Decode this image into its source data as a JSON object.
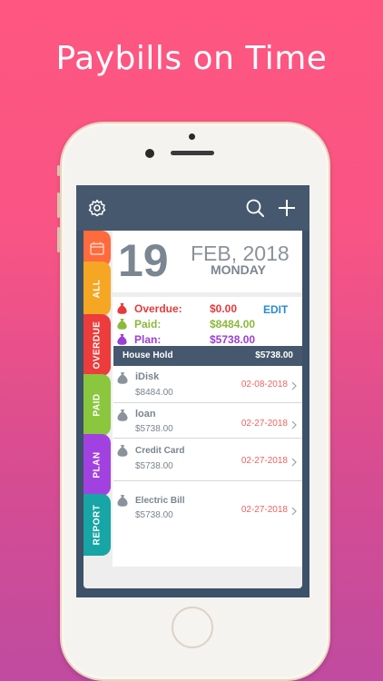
{
  "headline": "Paybills on Time",
  "date": {
    "day": "19",
    "month_year": "FEB, 2018",
    "weekday": "MONDAY"
  },
  "tabs": [
    {
      "label": "ALL",
      "color": "#f5a623"
    },
    {
      "label": "OVERDUE",
      "color": "#ec3c3c"
    },
    {
      "label": "PAID",
      "color": "#8bc63f"
    },
    {
      "label": "PLAN",
      "color": "#a142e0"
    },
    {
      "label": "REPORT",
      "color": "#17a5a5"
    }
  ],
  "calendar_tab_color": "#ff6b3d",
  "summary": {
    "overdue_label": "Overdue:",
    "overdue_value": "$0.00",
    "paid_label": "Paid:",
    "paid_value": "$8484.00",
    "plan_label": "Plan:",
    "plan_value": "$5738.00",
    "edit_label": "EDIT"
  },
  "colors": {
    "overdue": "#e53a3a",
    "paid": "#8bb93a",
    "plan": "#9a3fd6",
    "accent_blue": "#2a8ad7"
  },
  "group": {
    "title": "House Hold",
    "total": "$5738.00"
  },
  "bills": [
    {
      "name": "iDisk",
      "amount": "$8484.00",
      "date": "02-08-2018"
    },
    {
      "name": "loan",
      "amount": "$5738.00",
      "date": "02-27-2018"
    },
    {
      "name": "Credit Card",
      "amount": "$5738.00",
      "date": "02-27-2018"
    },
    {
      "name": "Electric Bill",
      "amount": "$5738.00",
      "date": "02-27-2018"
    }
  ],
  "icons": [
    "gear-icon",
    "search-icon",
    "plus-icon",
    "calendar-icon",
    "money-bag-icon",
    "chevron-right-icon"
  ]
}
